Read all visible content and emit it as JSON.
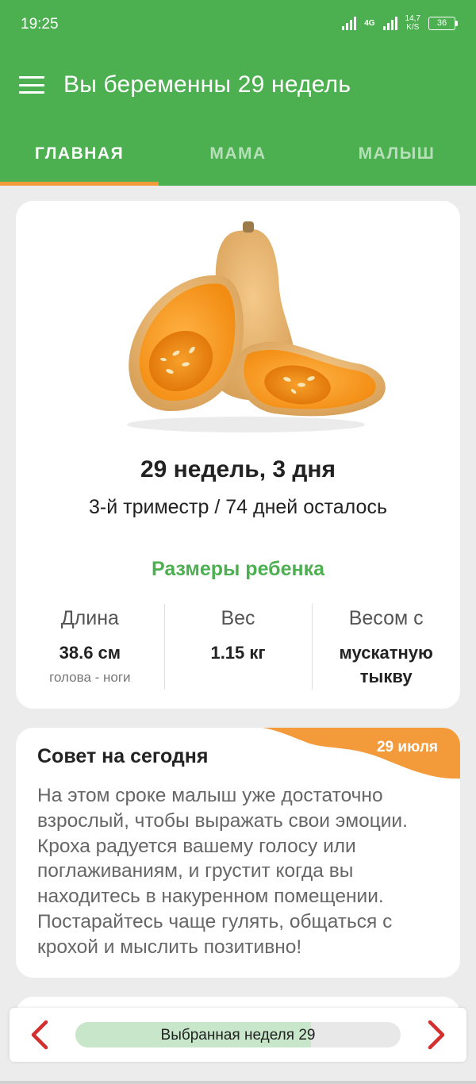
{
  "status_bar": {
    "time": "19:25",
    "network_type": "4G",
    "net_speed_value": "14,7",
    "net_speed_unit": "K/S",
    "battery": "36"
  },
  "app_bar": {
    "title": "Вы беременны 29 недель"
  },
  "tabs": [
    {
      "label": "ГЛАВНАЯ",
      "active": true
    },
    {
      "label": "МАМА",
      "active": false
    },
    {
      "label": "МАЛЫШ",
      "active": false
    }
  ],
  "week_card": {
    "image_subject": "butternut squash",
    "title": "29 недель, 3 дня",
    "subtitle": "3-й триместр / 74 дней осталось",
    "sizes_heading": "Размеры ребенка",
    "stats": [
      {
        "label": "Длина",
        "value": "38.6 см",
        "note": "голова - ноги"
      },
      {
        "label": "Вес",
        "value": "1.15 кг",
        "note": ""
      },
      {
        "label": "Весом с",
        "value": "мускатную тыкву",
        "note": ""
      }
    ]
  },
  "tip_card": {
    "title": "Совет на сегодня",
    "date": "29 июля",
    "text": "На этом сроке малыш уже достаточно взрослый, чтобы выражать свои эмоции. Кроха радуется вашему голосу или поглаживаниям, и грустит когда вы находитесь в накуренном помещении. Постарайтесь чаще гулять, общаться с крохой и мыслить позитивно!"
  },
  "week_selector": {
    "label": "Выбранная неделя 29",
    "progress_fraction": 0.725
  },
  "colors": {
    "primary_green": "#4caf50",
    "accent_orange": "#f39a3a",
    "arrow_red": "#d32f2f",
    "progress_fill": "#c8e6c9"
  }
}
